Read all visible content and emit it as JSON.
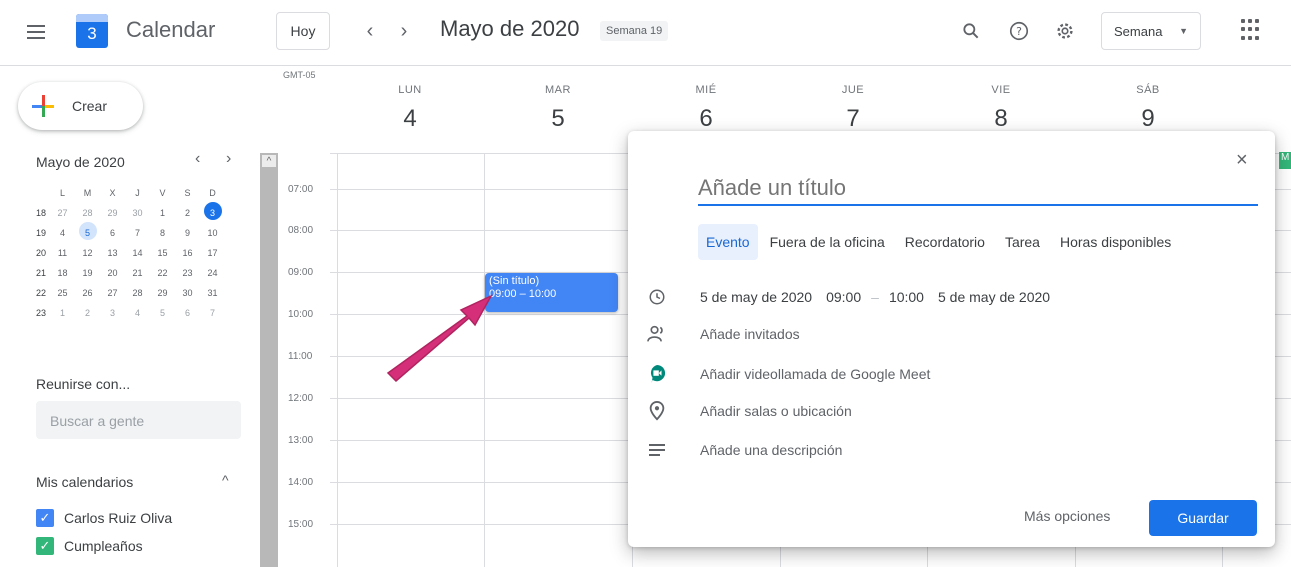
{
  "header": {
    "app_title": "Calendar",
    "logo_day": "3",
    "today_label": "Hoy",
    "prev_icon": "‹",
    "next_icon": "›",
    "month_title": "Mayo de 2020",
    "week_badge": "Semana 19",
    "view_label": "Semana",
    "icons": [
      "menu-icon",
      "search-icon",
      "help-icon",
      "settings-icon",
      "apps-icon"
    ]
  },
  "sidebar": {
    "create_label": "Crear",
    "mini_cal": {
      "title": "Mayo de 2020",
      "weekdays": [
        "L",
        "M",
        "X",
        "J",
        "V",
        "S",
        "D"
      ],
      "weeks": [
        {
          "wk": "18",
          "days": [
            "27",
            "28",
            "29",
            "30",
            "1",
            "2",
            "3"
          ]
        },
        {
          "wk": "19",
          "days": [
            "4",
            "5",
            "6",
            "7",
            "8",
            "9",
            "10"
          ]
        },
        {
          "wk": "20",
          "days": [
            "11",
            "12",
            "13",
            "14",
            "15",
            "16",
            "17"
          ]
        },
        {
          "wk": "21",
          "days": [
            "18",
            "19",
            "20",
            "21",
            "22",
            "23",
            "24"
          ]
        },
        {
          "wk": "22",
          "days": [
            "25",
            "26",
            "27",
            "28",
            "29",
            "30",
            "31"
          ]
        },
        {
          "wk": "23",
          "days": [
            "1",
            "2",
            "3",
            "4",
            "5",
            "6",
            "7"
          ]
        }
      ]
    },
    "meet_title": "Reunirse con...",
    "people_placeholder": "Buscar a gente",
    "my_calendars_title": "Mis calendarios",
    "calendars": [
      {
        "name": "Carlos Ruiz Oliva",
        "color": "#4285f4"
      },
      {
        "name": "Cumpleaños",
        "color": "#33b679"
      }
    ]
  },
  "grid": {
    "timezone": "GMT-05",
    "days": [
      {
        "name": "LUN",
        "num": "4"
      },
      {
        "name": "MAR",
        "num": "5"
      },
      {
        "name": "MIÉ",
        "num": "6"
      },
      {
        "name": "JUE",
        "num": "7"
      },
      {
        "name": "VIE",
        "num": "8"
      },
      {
        "name": "SÁB",
        "num": "9"
      }
    ],
    "hours": [
      "07:00",
      "08:00",
      "09:00",
      "10:00",
      "11:00",
      "12:00",
      "13:00",
      "14:00",
      "15:00"
    ],
    "event": {
      "title": "(Sin título)",
      "time": "09:00 – 10:00",
      "color": "#4285f4"
    },
    "chip_label": "M"
  },
  "dialog": {
    "title_placeholder": "Añade un título",
    "tabs": [
      "Evento",
      "Fuera de la oficina",
      "Recordatorio",
      "Tarea",
      "Horas disponibles"
    ],
    "start_date": "5 de may de 2020",
    "start_time": "09:00",
    "separator": "–",
    "end_time": "10:00",
    "end_date": "5 de may de 2020",
    "guests": "Añade invitados",
    "meet": "Añadir videollamada de Google Meet",
    "location": "Añadir salas o ubicación",
    "description": "Añade una descripción",
    "more_options": "Más opciones",
    "save": "Guardar",
    "close": "×"
  },
  "colors": {
    "accent": "#1a73e8",
    "arrow": "#d62f7a",
    "meet_green": "#00897b"
  }
}
